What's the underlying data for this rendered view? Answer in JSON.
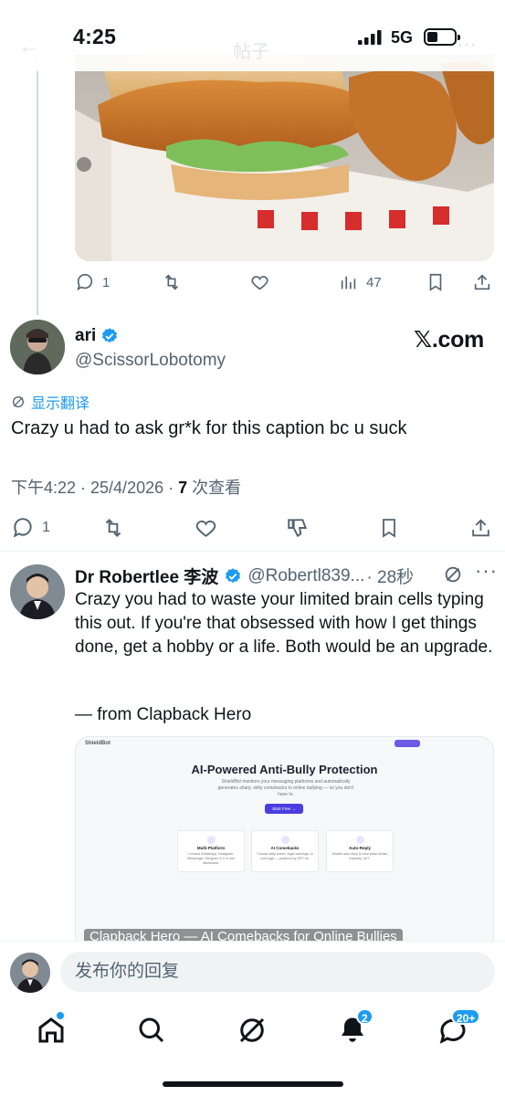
{
  "status_bar": {
    "time": "4:25",
    "network": "5G",
    "faded_title": "帖子"
  },
  "prev_tweet_actions": {
    "replies": "1",
    "views": "47"
  },
  "quoted_tweet": {
    "display_name": "ari",
    "handle": "@ScissorLobotomy",
    "source_watermark": "𝕏.com",
    "translate_label": "显示翻译",
    "text": "Crazy u had to ask gr*k for this caption bc u suck",
    "time": "下午4:22 · 25/4/2026 · ",
    "views_count": "7",
    "views_label": " 次查看",
    "replies": "1"
  },
  "reply_tweet": {
    "display_name": "Dr Robertlee 李波",
    "handle": "@Robertl839...",
    "age": "· 28秒",
    "text": "Crazy you had to waste your limited brain cells typing this out. If you're that obsessed with how I get things done, get a hobby or a life. Both would be an upgrade.",
    "signature": "— from Clapback Hero",
    "link_card": {
      "site_logo": "ShieldBot",
      "headline": "AI-Powered Anti-Bully Protection",
      "description": "ShieldBot monitors your messaging platforms and automatically generates sharp, witty comebacks to online bullying — so you don't have to.",
      "cta": "Start Free →",
      "features": [
        {
          "title": "Multi-Platform",
          "desc": "Connect WhatsApp, Instagram, Messenger, Telegram & X in one dashboard."
        },
        {
          "title": "AI Comebacks",
          "desc": "Choose witty humor, legal warnings, or cold logic — powered by GPT-4o."
        },
        {
          "title": "Auto-Reply",
          "desc": "Enable auto-reply to shut down bullies instantly, 24/7."
        }
      ],
      "caption": "Clapback Hero — AI Comebacks for Online Bullies"
    }
  },
  "reply_bar": {
    "placeholder": "发布你的回复"
  },
  "tab_bar": {
    "notifications_badge": "2",
    "messages_badge": "20+"
  },
  "colors": {
    "accent": "#1d9bf0",
    "secondary_text": "#536471",
    "primary_text": "#0f1419"
  }
}
